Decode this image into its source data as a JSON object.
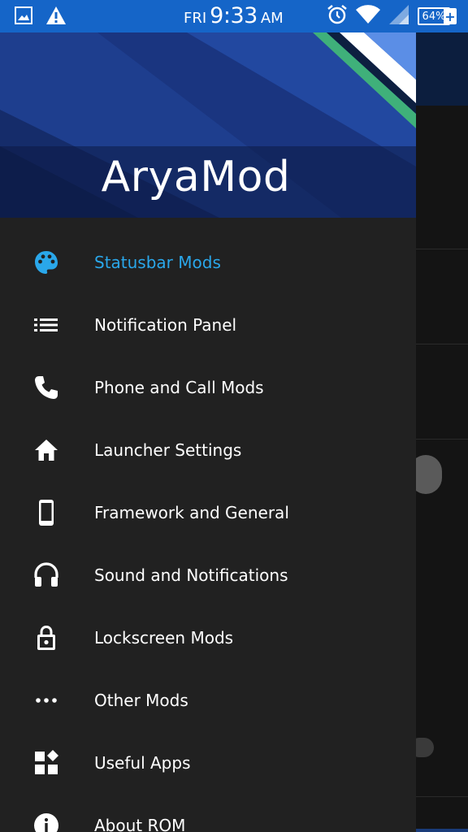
{
  "status_bar": {
    "day": "FRI",
    "time": "9:33",
    "ampm": "AM",
    "battery": "64%",
    "battery_plus": "+",
    "icons": [
      "gallery-icon",
      "warning-icon",
      "alarm-icon",
      "wifi-icon",
      "signal-icon",
      "battery-icon"
    ]
  },
  "drawer": {
    "title": "AryaMod",
    "accent": "#2aa7ea",
    "items": [
      {
        "label": "Statusbar Mods",
        "icon": "palette-icon",
        "active": true
      },
      {
        "label": "Notification Panel",
        "icon": "list-icon"
      },
      {
        "label": "Phone and Call Mods",
        "icon": "phone-icon"
      },
      {
        "label": "Launcher Settings",
        "icon": "home-icon"
      },
      {
        "label": "Framework and General",
        "icon": "smartphone-icon"
      },
      {
        "label": "Sound and Notifications",
        "icon": "headphones-icon"
      },
      {
        "label": "Lockscreen Mods",
        "icon": "lock-icon"
      },
      {
        "label": "Other Mods",
        "icon": "more-horiz-icon"
      },
      {
        "label": "Useful Apps",
        "icon": "widgets-icon"
      },
      {
        "label": "About ROM",
        "icon": "info-icon"
      }
    ]
  }
}
